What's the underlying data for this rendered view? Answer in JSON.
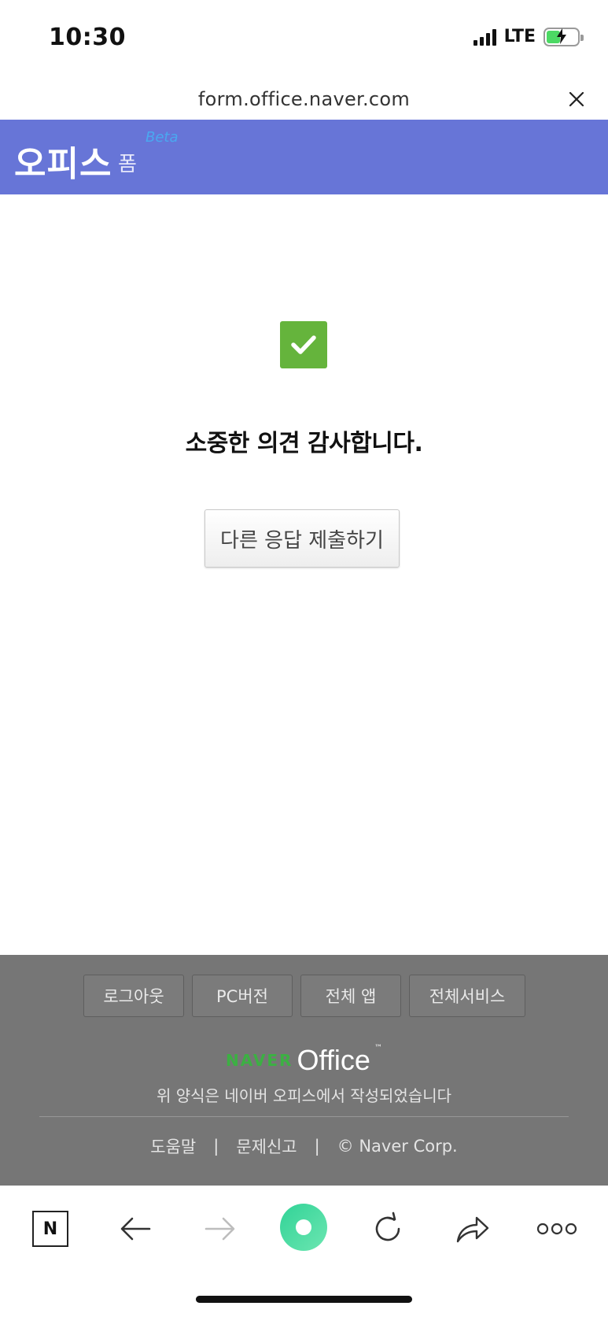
{
  "status_bar": {
    "time": "10:30",
    "network": "LTE"
  },
  "browser": {
    "url": "form.office.naver.com"
  },
  "header": {
    "brand": "오피스",
    "product": "폼",
    "badge": "Beta"
  },
  "main": {
    "message": "소중한 의견 감사합니다.",
    "resubmit_label": "다른 응답 제출하기"
  },
  "footer": {
    "buttons": [
      {
        "label": "로그아웃"
      },
      {
        "label": "PC버전"
      },
      {
        "label": "전체 앱"
      },
      {
        "label": "전체서비스"
      }
    ],
    "logo_naver": "NAVER",
    "logo_office": "Office",
    "logo_tm": "™",
    "note": "위 양식은 네이버 오피스에서 작성되었습니다",
    "links": [
      {
        "label": "도움말"
      },
      {
        "label": "문제신고"
      },
      {
        "label": "© Naver Corp."
      }
    ],
    "separator": "|"
  },
  "toolbar": {
    "naver_label": "N",
    "icons": [
      "naver-n-icon",
      "back-arrow-icon",
      "forward-arrow-icon",
      "home-green-icon",
      "refresh-icon",
      "share-icon",
      "more-icon"
    ]
  },
  "colors": {
    "header_bg": "#6775d7",
    "check_green": "#65b43c",
    "footer_bg": "#767676",
    "naver_green": "#3cb043"
  }
}
